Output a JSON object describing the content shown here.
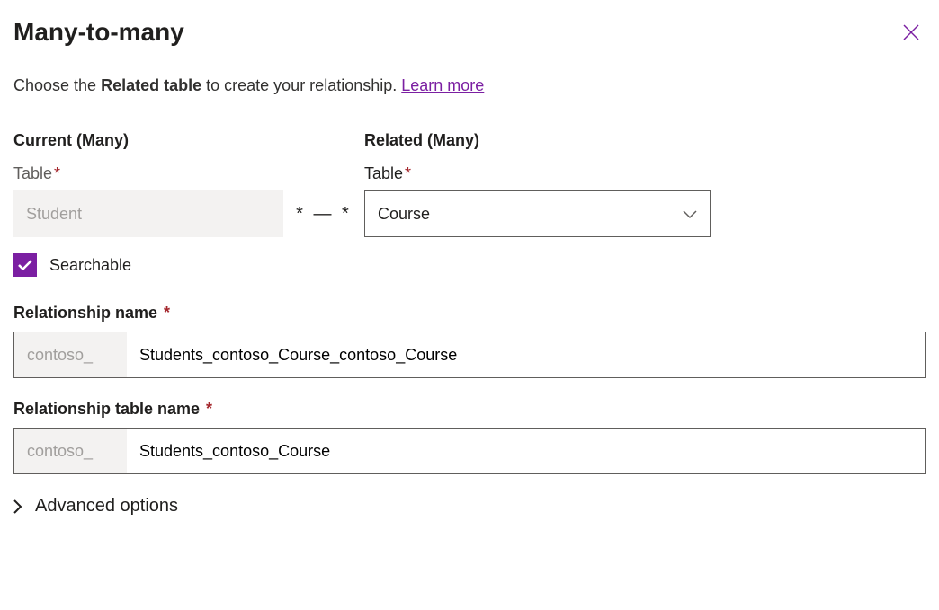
{
  "header": {
    "title": "Many-to-many"
  },
  "intro": {
    "prefix": "Choose the ",
    "bold": "Related table",
    "suffix": " to create your relationship. ",
    "link": "Learn more"
  },
  "current": {
    "heading": "Current (Many)",
    "table_label": "Table",
    "table_value": "Student"
  },
  "connector": "*  —  *",
  "related": {
    "heading": "Related (Many)",
    "table_label": "Table",
    "table_value": "Course"
  },
  "checkbox": {
    "label": "Searchable",
    "checked": true
  },
  "rel_name": {
    "label": "Relationship name",
    "prefix": "contoso_",
    "value": "Students_contoso_Course_contoso_Course"
  },
  "rel_table_name": {
    "label": "Relationship table name",
    "prefix": "contoso_",
    "value": "Students_contoso_Course"
  },
  "advanced": {
    "label": "Advanced options"
  }
}
